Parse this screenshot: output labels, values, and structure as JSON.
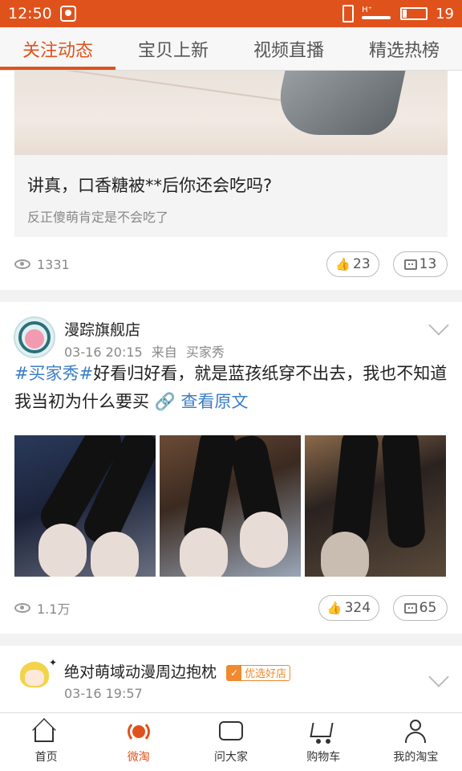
{
  "status_bar": {
    "time": "12:50",
    "battery": "19",
    "signal": "H⁺"
  },
  "tabs": [
    {
      "label": "关注动态",
      "active": true
    },
    {
      "label": "宝贝上新",
      "active": false
    },
    {
      "label": "视频直播",
      "active": false
    },
    {
      "label": "精选热榜",
      "active": false
    }
  ],
  "post1": {
    "quote_title": "讲真，口香糖被**后你还会吃吗?",
    "quote_sub": "反正傻萌肯定是不会吃了",
    "views": "1331",
    "likes": "23",
    "comments": "13"
  },
  "post2": {
    "shop": "漫踪旗舰店",
    "time": "03-16 20:15",
    "from": "来自",
    "source": "买家秀",
    "tag": "#买家秀#",
    "text": "好看归好看，就是蓝孩纸穿不出去，我也不知道我当初为什么要买",
    "link": "查看原文",
    "views": "1.1万",
    "likes": "324",
    "comments": "65"
  },
  "post3": {
    "shop": "绝对萌域动漫周边抱枕",
    "badge": "优选好店",
    "time": "03-16 19:57"
  },
  "nav": [
    {
      "label": "首页",
      "icon": "home-icon",
      "active": false
    },
    {
      "label": "微淘",
      "icon": "weitao-icon",
      "active": true
    },
    {
      "label": "问大家",
      "icon": "ask-icon",
      "active": false
    },
    {
      "label": "购物车",
      "icon": "cart-icon",
      "active": false
    },
    {
      "label": "我的淘宝",
      "icon": "profile-icon",
      "active": false
    }
  ],
  "colors": {
    "accent": "#e0521c",
    "link": "#3b7dc6"
  }
}
